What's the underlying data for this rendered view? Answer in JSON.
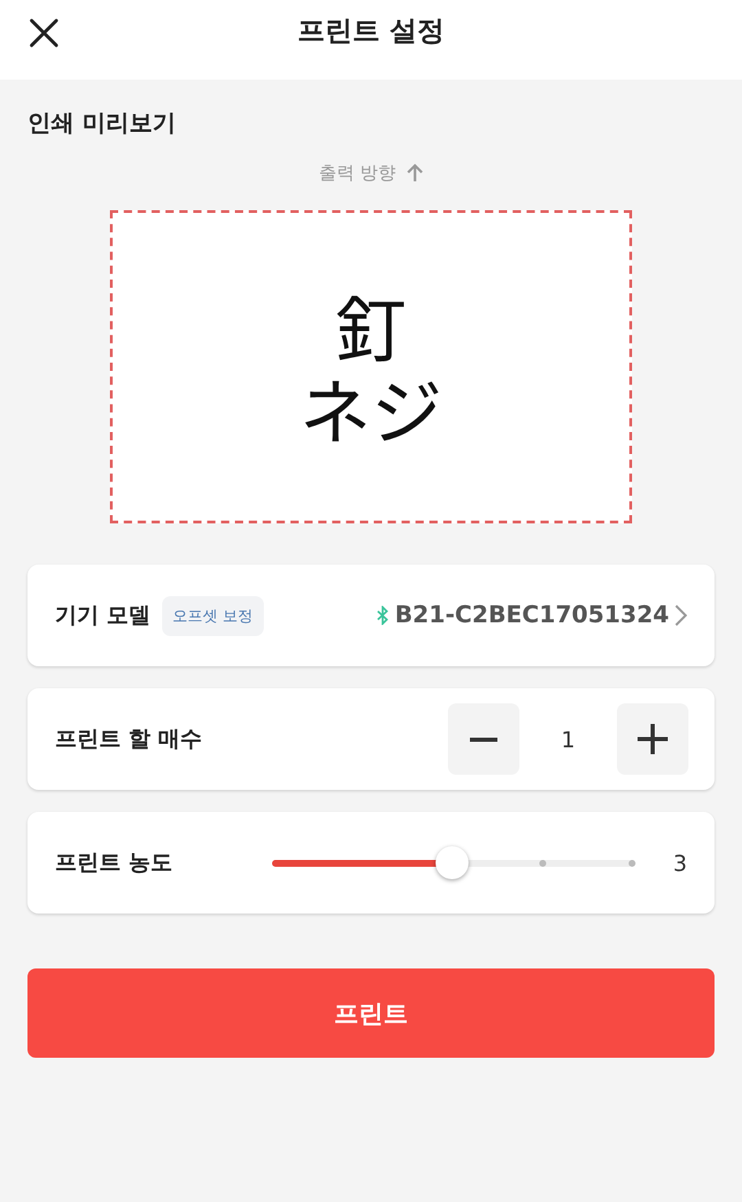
{
  "header": {
    "title": "프린트 설정"
  },
  "preview": {
    "heading": "인쇄 미리보기",
    "direction": "출력 방향",
    "label_lines": [
      "釘",
      "ネジ"
    ]
  },
  "device": {
    "label": "기기 모델",
    "badge": "오프셋 보정",
    "connected": true,
    "model": "B21-C2BEC17051324"
  },
  "copies": {
    "label": "프린트 할 매수",
    "value": "1"
  },
  "density": {
    "label": "프린트 농도",
    "level": 0.5,
    "reading": "3"
  },
  "print_button": "프린트"
}
